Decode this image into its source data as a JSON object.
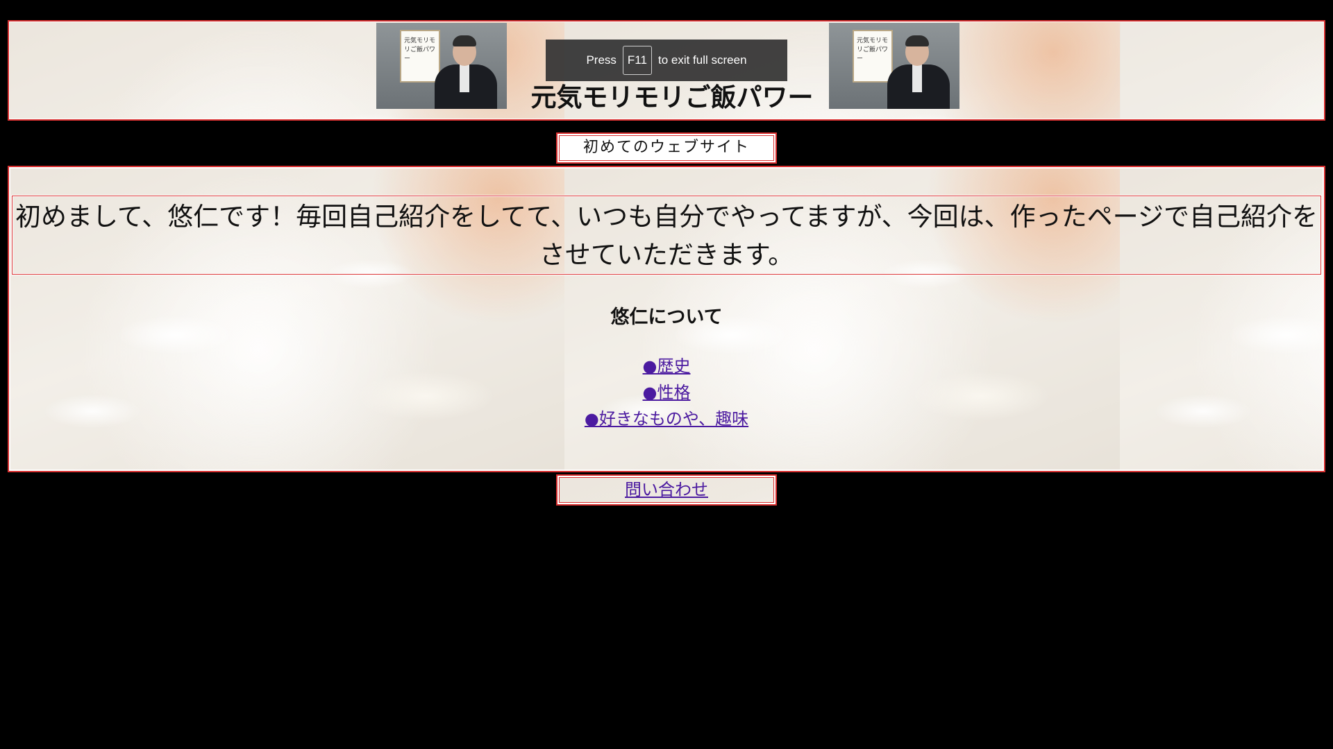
{
  "header": {
    "site_title": "元気モリモリご飯パワー",
    "photo_sign_text": "元気モリモリご飯パワー"
  },
  "fullscreen_toast": {
    "press": "Press",
    "key": "F11",
    "suffix": "to exit full screen"
  },
  "subtitle": "初めてのウェブサイト",
  "main": {
    "intro": "初めまして、悠仁です！毎回自己紹介をしてて、いつも自分でやってますが、今回は、作ったページで自己紹介をさせていただきます。",
    "about_heading": "悠仁について",
    "links": [
      {
        "label": "●歴史"
      },
      {
        "label": "●性格"
      },
      {
        "label": "●好きなものや、趣味"
      }
    ]
  },
  "contact_link": "問い合わせ",
  "colors": {
    "border": "#d93030",
    "link": "#4b1aa0",
    "page_background": "#000000"
  }
}
